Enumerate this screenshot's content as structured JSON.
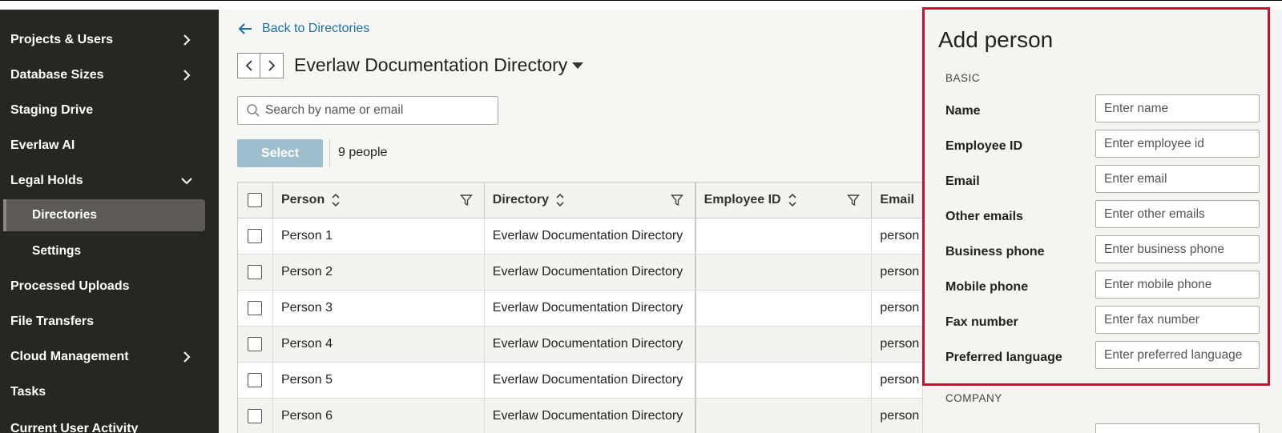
{
  "sidebar": {
    "items": [
      {
        "label": "Projects & Users",
        "chevron": "right"
      },
      {
        "label": "Database Sizes",
        "chevron": "right"
      },
      {
        "label": "Staging Drive",
        "chevron": ""
      },
      {
        "label": "Everlaw AI",
        "chevron": ""
      },
      {
        "label": "Legal Holds",
        "chevron": "down"
      },
      {
        "label": "Directories",
        "chevron": "",
        "active": true,
        "sub": true
      },
      {
        "label": "Settings",
        "chevron": "",
        "sub": true
      },
      {
        "label": "Processed Uploads",
        "chevron": ""
      },
      {
        "label": "File Transfers",
        "chevron": ""
      },
      {
        "label": "Cloud Management",
        "chevron": "right"
      },
      {
        "label": "Tasks",
        "chevron": ""
      },
      {
        "label": "Current User Activity",
        "chevron": ""
      }
    ]
  },
  "main": {
    "back_label": "Back to Directories",
    "directory_title": "Everlaw Documentation Directory",
    "search_placeholder": "Search by name or email",
    "select_label": "Select",
    "people_count": "9 people",
    "table": {
      "headers": [
        "Person",
        "Directory",
        "Employee ID",
        "Email"
      ],
      "rows": [
        {
          "person": "Person 1",
          "directory": "Everlaw Documentation Directory",
          "employee_id": "",
          "email": "person"
        },
        {
          "person": "Person 2",
          "directory": "Everlaw Documentation Directory",
          "employee_id": "",
          "email": "person"
        },
        {
          "person": "Person 3",
          "directory": "Everlaw Documentation Directory",
          "employee_id": "",
          "email": "person"
        },
        {
          "person": "Person 4",
          "directory": "Everlaw Documentation Directory",
          "employee_id": "",
          "email": "person"
        },
        {
          "person": "Person 5",
          "directory": "Everlaw Documentation Directory",
          "employee_id": "",
          "email": "person"
        },
        {
          "person": "Person 6",
          "directory": "Everlaw Documentation Directory",
          "employee_id": "",
          "email": "person"
        }
      ]
    }
  },
  "panel": {
    "title": "Add person",
    "section_basic": "BASIC",
    "section_company": "COMPANY",
    "fields": [
      {
        "label": "Name",
        "placeholder": "Enter name"
      },
      {
        "label": "Employee ID",
        "placeholder": "Enter employee id"
      },
      {
        "label": "Email",
        "placeholder": "Enter email"
      },
      {
        "label": "Other emails",
        "placeholder": "Enter other emails"
      },
      {
        "label": "Business phone",
        "placeholder": "Enter business phone"
      },
      {
        "label": "Mobile phone",
        "placeholder": "Enter mobile phone"
      },
      {
        "label": "Fax number",
        "placeholder": "Enter fax number"
      },
      {
        "label": "Preferred language",
        "placeholder": "Enter preferred language"
      }
    ]
  },
  "colors": {
    "sidebar_bg": "#262624",
    "link": "#1f6fa6",
    "select_button": "#9fbfcf",
    "highlight": "#c8102e"
  }
}
